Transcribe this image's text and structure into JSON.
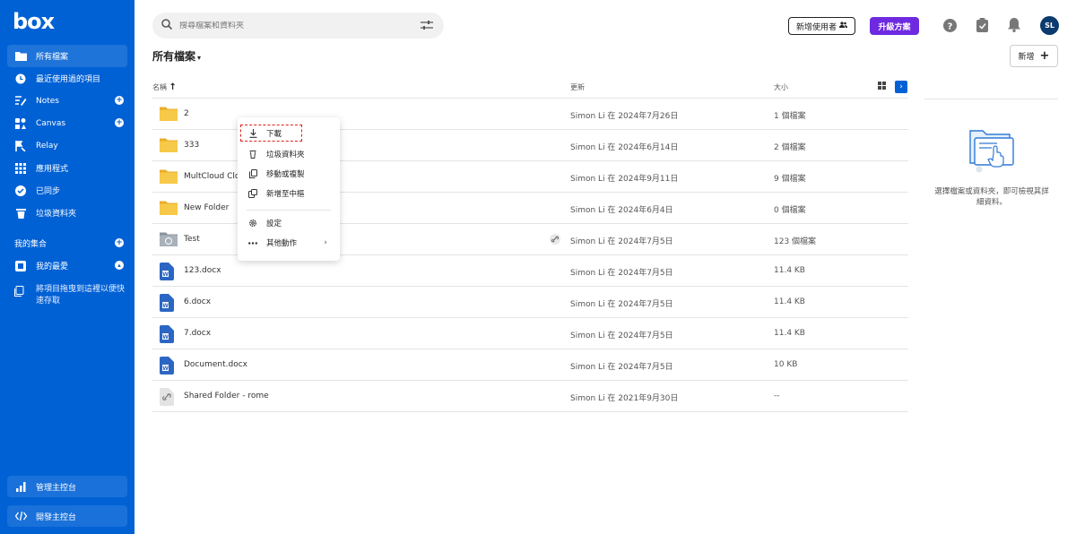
{
  "sidebar": {
    "logo": "box",
    "items": [
      {
        "label": "所有檔案"
      },
      {
        "label": "最近使用過的項目"
      },
      {
        "label": "Notes"
      },
      {
        "label": "Canvas"
      },
      {
        "label": "Relay"
      },
      {
        "label": "應用程式"
      },
      {
        "label": "已同步"
      },
      {
        "label": "垃圾資料夾"
      }
    ],
    "collections_label": "我的集合",
    "favorites_label": "我的最愛",
    "drag_hint": "將項目拖曳到這裡以便快速存取",
    "admin_console": "管理主控台",
    "dev_console": "開發主控台"
  },
  "search": {
    "placeholder": "搜尋檔案和資料夾"
  },
  "header": {
    "invite_label": "新增使用者",
    "upgrade_label": "升級方案",
    "avatar_initials": "SL"
  },
  "main": {
    "title": "所有檔案",
    "new_label": "新增",
    "columns": {
      "name": "名稱",
      "updated": "更新",
      "size": "大小"
    },
    "rows": [
      {
        "name": "2",
        "updated": "Simon Li 在 2024年7月26日",
        "size": "1 個檔案",
        "type": "folder"
      },
      {
        "name": "333",
        "updated": "Simon Li 在 2024年6月14日",
        "size": "2 個檔案",
        "type": "folder"
      },
      {
        "name": "MultCloud Clo",
        "updated": "Simon Li 在 2024年9月11日",
        "size": "9 個檔案",
        "type": "folder"
      },
      {
        "name": "New Folder",
        "updated": "Simon Li 在 2024年6月4日",
        "size": "0 個檔案",
        "type": "folder"
      },
      {
        "name": "Test",
        "updated": "Simon Li 在 2024年7月5日",
        "size": "123 個檔案",
        "type": "shared-folder"
      },
      {
        "name": "123.docx",
        "updated": "Simon Li 在 2024年7月5日",
        "size": "11.4 KB",
        "type": "docx"
      },
      {
        "name": "6.docx",
        "updated": "Simon Li 在 2024年7月5日",
        "size": "11.4 KB",
        "type": "docx"
      },
      {
        "name": "7.docx",
        "updated": "Simon Li 在 2024年7月5日",
        "size": "11.4 KB",
        "type": "docx"
      },
      {
        "name": "Document.docx",
        "updated": "Simon Li 在 2024年7月5日",
        "size": "10 KB",
        "type": "docx"
      },
      {
        "name": "Shared Folder - rome",
        "updated": "Simon Li 在 2021年9月30日",
        "size": "--",
        "type": "link"
      }
    ]
  },
  "detail": {
    "empty_text": "選擇檔案或資料夾，即可檢視其詳細資料。"
  },
  "context_menu": {
    "download": "下載",
    "trash": "垃圾資料夾",
    "move_copy": "移動或複製",
    "add_to_hub": "新增至中樞",
    "settings": "設定",
    "more_actions": "其他動作"
  },
  "colors": {
    "sidebar": "#0061d5",
    "upgrade": "#6e2ae0",
    "folder": "#f7c948",
    "highlight": "#e0201a"
  }
}
